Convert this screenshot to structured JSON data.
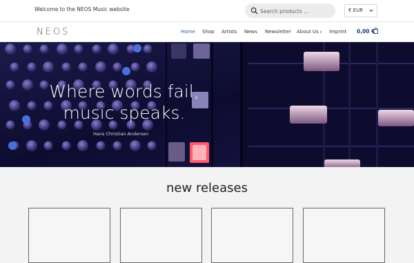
{
  "topbar": {
    "welcome": "Welcome to the NEOS Music website",
    "search_placeholder": "Search products ...",
    "currency": "€ EUR"
  },
  "nav": {
    "logo": "NEOS",
    "items": [
      {
        "label": "Home",
        "active": true
      },
      {
        "label": "Shop",
        "active": false
      },
      {
        "label": "Artists",
        "active": false
      },
      {
        "label": "News",
        "active": false
      },
      {
        "label": "Newsletter",
        "active": false
      },
      {
        "label": "About Us",
        "active": false
      },
      {
        "label": "Imprint",
        "active": false
      }
    ],
    "cart_total": "0,00 €"
  },
  "hero": {
    "title_line1": "Where words fail,",
    "title_line2": "music speaks.",
    "author": "Hans Christian Andersen"
  },
  "releases": {
    "title": "new releases",
    "cards": [
      "",
      "",
      "",
      ""
    ]
  },
  "colors": {
    "accent": "#2c5aa0",
    "cart": "#1f3f75",
    "hero_bg": "#0c0b28"
  }
}
